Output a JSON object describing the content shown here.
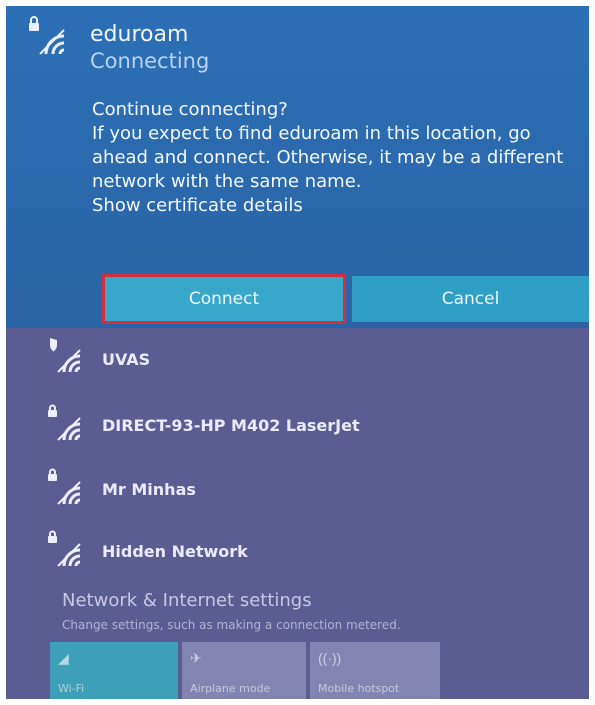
{
  "active_network": {
    "ssid": "eduroam",
    "status": "Connecting",
    "prompt_title": "Continue connecting?",
    "prompt_body": "If you expect to find eduroam in this location, go ahead and connect. Otherwise, it may be a different network with the same name.",
    "certificate_link": "Show certificate details",
    "connect_label": "Connect",
    "cancel_label": "Cancel",
    "icon": "wifi-secured-icon"
  },
  "networks": [
    {
      "name": "UVAS",
      "icon": "wifi-shield-icon"
    },
    {
      "name": "DIRECT-93-HP M402 LaserJet",
      "icon": "wifi-secured-icon"
    },
    {
      "name": "Mr Minhas",
      "icon": "wifi-secured-icon"
    },
    {
      "name": "Hidden Network",
      "icon": "wifi-secured-icon"
    }
  ],
  "settings": {
    "title": "Network & Internet settings",
    "subtitle": "Change settings, such as making a connection metered."
  },
  "quick_actions": [
    {
      "label": "Wi-Fi",
      "icon": "wifi-icon",
      "color": "#3e9fb8"
    },
    {
      "label": "Airplane mode",
      "icon": "airplane-icon",
      "color": "#8384b2"
    },
    {
      "label": "Mobile hotspot",
      "icon": "hotspot-icon",
      "color": "#8384b2"
    }
  ],
  "colors": {
    "accent": "#2fa1c4",
    "highlight_box": "#d2303f",
    "panel": "#5b5c92"
  }
}
